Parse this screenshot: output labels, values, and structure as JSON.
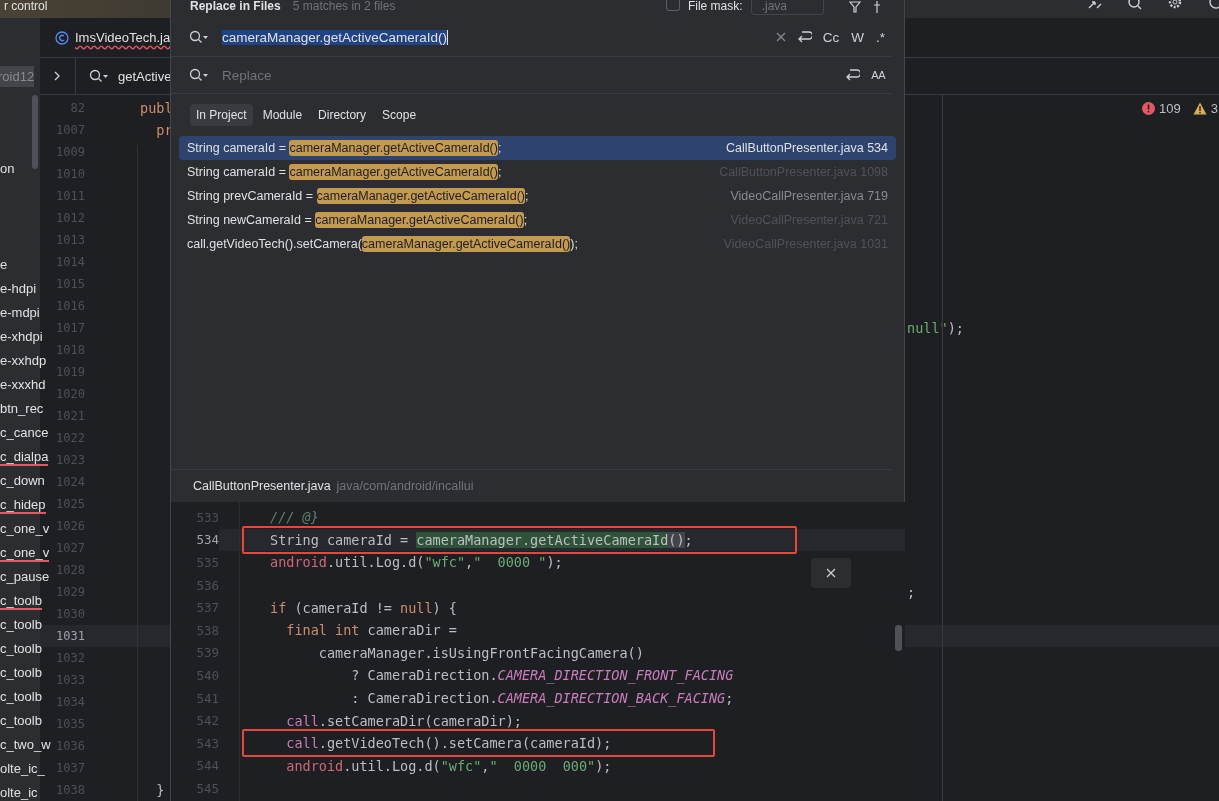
{
  "title_bar": {
    "title": "r control"
  },
  "editor_tab": {
    "label": "ImsVideoTech.ja",
    "has_error": true
  },
  "project_panel": {
    "root": "roid12",
    "items_upper": [
      {
        "label": "on",
        "error": false
      }
    ],
    "items": [
      {
        "label": "e",
        "error": false
      },
      {
        "label": "e-hdpi",
        "error": false
      },
      {
        "label": "e-mdpi",
        "error": false
      },
      {
        "label": "e-xhdpi",
        "error": false
      },
      {
        "label": "e-xxhdp",
        "error": false
      },
      {
        "label": "e-xxxhd",
        "error": false
      },
      {
        "label": "btn_rec",
        "error": false
      },
      {
        "label": "c_cance",
        "error": false
      },
      {
        "label": "c_dialpa",
        "error": true
      },
      {
        "label": "c_down",
        "error": false
      },
      {
        "label": "c_hidep",
        "error": true
      },
      {
        "label": "c_one_v",
        "error": false
      },
      {
        "label": "c_one_v",
        "error": true
      },
      {
        "label": "c_pause",
        "error": false
      },
      {
        "label": "c_toolb",
        "error": true
      },
      {
        "label": "c_toolb",
        "error": false
      },
      {
        "label": "c_toolb",
        "error": false
      },
      {
        "label": "c_toolb",
        "error": false
      },
      {
        "label": "c_toolb",
        "error": false
      },
      {
        "label": "c_toolb",
        "error": false
      },
      {
        "label": "c_two_w",
        "error": false
      },
      {
        "label": "olte_ic_",
        "error": false
      },
      {
        "label": "olte_ic",
        "error": false
      }
    ]
  },
  "breadcrumb": {
    "search_text": "getActive"
  },
  "editor": {
    "inspections": {
      "errors": "109",
      "warnings": "3"
    },
    "lines": [
      {
        "number": "82",
        "current": false,
        "left": [
          {
            "kind": "keyword",
            "text": "publ"
          }
        ]
      },
      {
        "number": "1007",
        "current": false,
        "left": [
          {
            "kind": "keyword",
            "text": "  pr"
          }
        ]
      },
      {
        "number": "1009",
        "current": false
      },
      {
        "number": "1010",
        "current": false
      },
      {
        "number": "1011",
        "current": false
      },
      {
        "number": "1012",
        "current": false
      },
      {
        "number": "1013",
        "current": false
      },
      {
        "number": "1014",
        "current": false
      },
      {
        "number": "1015",
        "current": false
      },
      {
        "number": "1016",
        "current": false
      },
      {
        "number": "1017",
        "current": false,
        "right": [
          {
            "kind": "string",
            "text": "null\""
          },
          {
            "kind": "plain",
            "text": ");"
          }
        ]
      },
      {
        "number": "1018",
        "current": false
      },
      {
        "number": "1019",
        "current": false
      },
      {
        "number": "1020",
        "current": false
      },
      {
        "number": "1021",
        "current": false
      },
      {
        "number": "1022",
        "current": false
      },
      {
        "number": "1023",
        "current": false
      },
      {
        "number": "1024",
        "current": false
      },
      {
        "number": "1025",
        "current": false
      },
      {
        "number": "1026",
        "current": false
      },
      {
        "number": "1027",
        "current": false
      },
      {
        "number": "1028",
        "current": false
      },
      {
        "number": "1029",
        "current": false,
        "right": [
          {
            "kind": "plain",
            "text": ";"
          }
        ]
      },
      {
        "number": "1030",
        "current": false
      },
      {
        "number": "1031",
        "current": true
      },
      {
        "number": "1032",
        "current": false
      },
      {
        "number": "1033",
        "current": false
      },
      {
        "number": "1034",
        "current": false
      },
      {
        "number": "1035",
        "current": false
      },
      {
        "number": "1036",
        "current": false
      },
      {
        "number": "1037",
        "current": false
      },
      {
        "number": "1038",
        "current": false,
        "left": [
          {
            "kind": "plain",
            "text": "  }"
          }
        ]
      }
    ]
  },
  "dialog": {
    "title": "Replace in Files",
    "summary": "5 matches in 2 files",
    "file_mask": {
      "checked": false,
      "label": "File mask:",
      "value": ".java"
    },
    "search": {
      "value": "cameraManager.getActiveCameraId()"
    },
    "search_options": [
      {
        "label": "Cc",
        "selected": false
      },
      {
        "label": "W",
        "selected": false
      },
      {
        "label": ".*",
        "selected": false
      }
    ],
    "replace": {
      "placeholder": "Replace"
    },
    "replace_options": [
      {
        "label": "AA",
        "selected": false
      }
    ],
    "scopes": [
      {
        "label": "In Project",
        "selected": true
      },
      {
        "label": "Module",
        "selected": false
      },
      {
        "label": "Directory",
        "selected": false
      },
      {
        "label": "Scope",
        "selected": false
      }
    ],
    "results": [
      {
        "prefix": "String cameraId = ",
        "match": "cameraManager.getActiveCameraId()",
        "suffix": ";",
        "location": "CallButtonPresenter.java 534",
        "selected": true,
        "dimmed": false
      },
      {
        "prefix": "String cameraId = ",
        "match": "cameraManager.getActiveCameraId()",
        "suffix": ";",
        "location": "CallButtonPresenter.java 1098",
        "selected": false,
        "dimmed": true
      },
      {
        "prefix": "String prevCameraId = ",
        "match": "cameraManager.getActiveCameraId()",
        "suffix": ";",
        "location": "VideoCallPresenter.java 719",
        "selected": false,
        "dimmed": false
      },
      {
        "prefix": "String newCameraId = ",
        "match": "cameraManager.getActiveCameraId()",
        "suffix": ";",
        "location": "VideoCallPresenter.java 721",
        "selected": false,
        "dimmed": true
      },
      {
        "prefix": "call.getVideoTech().setCamera(",
        "match": "cameraManager.getActiveCameraId()",
        "suffix": ");",
        "location": "VideoCallPresenter.java 1031",
        "selected": false,
        "dimmed": true
      }
    ],
    "preview": {
      "file": "CallButtonPresenter.java",
      "path": "java/com/android/incallui",
      "lines": [
        {
          "number": "533",
          "current": false,
          "boxed": false,
          "tokens": [
            {
              "kind": "comment",
              "text": "/// @}"
            }
          ]
        },
        {
          "number": "534",
          "current": true,
          "boxed": true,
          "tokens": [
            {
              "kind": "plain",
              "text": "String cameraId = "
            },
            {
              "kind": "match",
              "text": "cameraManager.getActiveCameraId"
            },
            {
              "kind": "brace",
              "text": "()"
            },
            {
              "kind": "plain",
              "text": ";"
            }
          ]
        },
        {
          "number": "535",
          "current": false,
          "boxed": false,
          "tokens": [
            {
              "kind": "package",
              "text": "android"
            },
            {
              "kind": "plain",
              "text": ".util.Log.d("
            },
            {
              "kind": "string",
              "text": "\"wfc\""
            },
            {
              "kind": "plain",
              "text": ","
            },
            {
              "kind": "string",
              "text": "\"  0000 \""
            },
            {
              "kind": "plain",
              "text": ");"
            }
          ]
        },
        {
          "number": "536",
          "current": false,
          "boxed": false
        },
        {
          "number": "537",
          "current": false,
          "boxed": false,
          "tokens": [
            {
              "kind": "keyword",
              "text": "if"
            },
            {
              "kind": "plain",
              "text": " (cameraId != "
            },
            {
              "kind": "keyword",
              "text": "null"
            },
            {
              "kind": "plain",
              "text": ") {"
            }
          ]
        },
        {
          "number": "538",
          "current": false,
          "boxed": false,
          "tokens": [
            {
              "kind": "keyword",
              "text": "  final int"
            },
            {
              "kind": "plain",
              "text": " cameraDir ="
            }
          ]
        },
        {
          "number": "539",
          "current": false,
          "boxed": false,
          "tokens": [
            {
              "kind": "plain",
              "text": "      cameraManager.isUsingFrontFacingCamera()"
            }
          ]
        },
        {
          "number": "540",
          "current": false,
          "boxed": false,
          "tokens": [
            {
              "kind": "plain",
              "text": "          ? CameraDirection."
            },
            {
              "kind": "constant",
              "text": "CAMERA_DIRECTION_FRONT_FACING"
            }
          ]
        },
        {
          "number": "541",
          "current": false,
          "boxed": false,
          "tokens": [
            {
              "kind": "plain",
              "text": "          : CameraDirection."
            },
            {
              "kind": "constant",
              "text": "CAMERA_DIRECTION_BACK_FACING"
            },
            {
              "kind": "plain",
              "text": ";"
            }
          ]
        },
        {
          "number": "542",
          "current": false,
          "boxed": false,
          "tokens": [
            {
              "kind": "variable",
              "text": "  call"
            },
            {
              "kind": "plain",
              "text": ".setCameraDir(cameraDir);"
            }
          ]
        },
        {
          "number": "543",
          "current": false,
          "boxed": true,
          "tokens": [
            {
              "kind": "variable",
              "text": "  call"
            },
            {
              "kind": "plain",
              "text": ".getVideoTech().setCamera(cameraId);"
            }
          ]
        },
        {
          "number": "544",
          "current": false,
          "boxed": false,
          "tokens": [
            {
              "kind": "package",
              "text": "  android"
            },
            {
              "kind": "plain",
              "text": ".util.Log.d("
            },
            {
              "kind": "string",
              "text": "\"wfc\""
            },
            {
              "kind": "plain",
              "text": ","
            },
            {
              "kind": "string",
              "text": "\"  0000  000\""
            },
            {
              "kind": "plain",
              "text": ");"
            }
          ]
        },
        {
          "number": "545",
          "current": false,
          "boxed": false
        }
      ]
    }
  }
}
